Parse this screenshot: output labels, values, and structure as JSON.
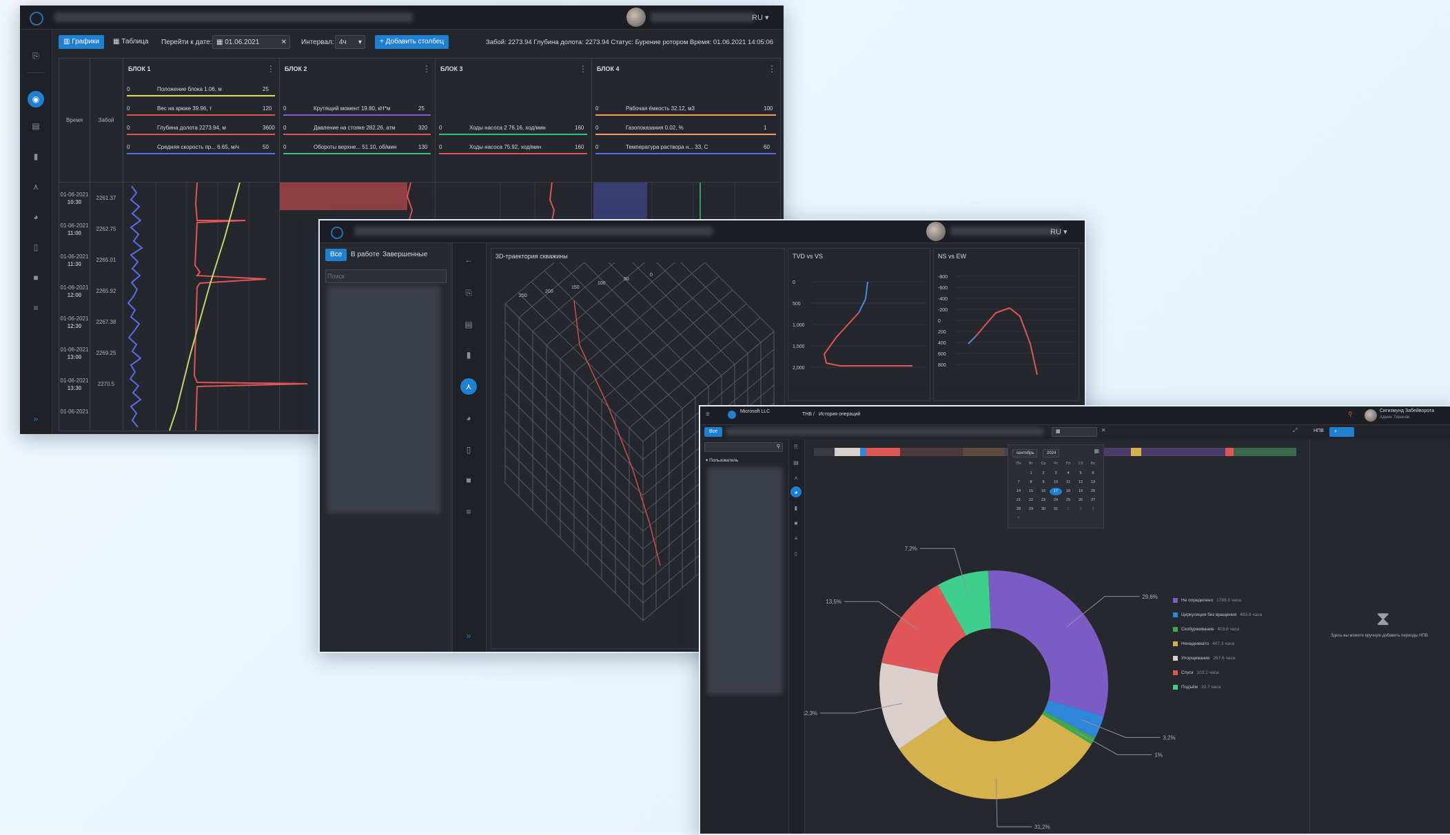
{
  "window1": {
    "lang": "RU",
    "toolbar": {
      "graphs_label": "Графики",
      "table_label": "Таблица",
      "goto_date_label": "Перейти к дате:",
      "date_value": "01.06.2021",
      "interval_label": "Интервал:",
      "interval_value": "4ч",
      "add_column_label": "+ Добавить столбец",
      "status_line": "Забой: 2273.94    Глубина долота: 2273.94    Статус: Бурение ротором    Время: 01.06.2021 14:05:06"
    },
    "columns": {
      "time": "Время",
      "depth": "Забой"
    },
    "blocks": [
      {
        "title": "БЛОК 1",
        "params": [
          {
            "label": "Положение блока 1.06, м",
            "min": "0",
            "max": "25",
            "color": "#e7e253"
          },
          {
            "label": "Вес на крюке 39.96, т",
            "min": "0",
            "max": "120",
            "color": "#e25555"
          },
          {
            "label": "Глубина долота 2273.94, м",
            "min": "0",
            "max": "3600",
            "color": "#e25555"
          },
          {
            "label": "Средняя скорость пр... 6.65, м/ч",
            "min": "0",
            "max": "50",
            "color": "#5a6ce8"
          }
        ]
      },
      {
        "title": "БЛОК 2",
        "params": [
          {
            "label": "Крутящий момент 19.80, кН*м",
            "min": "0",
            "max": "25",
            "color": "#8a5ad6"
          },
          {
            "label": "Давление на стояке 282.26, атм",
            "min": "0",
            "max": "320",
            "color": "#e25555"
          },
          {
            "label": "Обороты верхне... 51.10, об/мин",
            "min": "0",
            "max": "130",
            "color": "#3fc07a"
          }
        ]
      },
      {
        "title": "БЛОК 3",
        "params": [
          {
            "label": "Ходы насоса 2 76.16, ход/мин",
            "min": "0",
            "max": "160",
            "color": "#3fc07a"
          },
          {
            "label": "Ходы насоса 75.92, ход/мин",
            "min": "0",
            "max": "160",
            "color": "#e25555"
          }
        ]
      },
      {
        "title": "БЛОК 4",
        "params": [
          {
            "label": "Рабочая ёмкость 32.12, м3",
            "min": "0",
            "max": "100",
            "color": "#e7a553"
          },
          {
            "label": "Газопоказания 0.02, %",
            "min": "0",
            "max": "1",
            "color": "#e7a553"
          },
          {
            "label": "Температура раствора н... 33, С",
            "min": "0",
            "max": "60",
            "color": "#5a6ce8"
          }
        ]
      }
    ],
    "rows": [
      {
        "date": "01-06-2021",
        "time": "10:30",
        "depth": "2261.37"
      },
      {
        "date": "01-06-2021",
        "time": "11:00",
        "depth": "2262.75"
      },
      {
        "date": "01-06-2021",
        "time": "11:30",
        "depth": "2265.01"
      },
      {
        "date": "01-06-2021",
        "time": "12:00",
        "depth": "2265.92"
      },
      {
        "date": "01-06-2021",
        "time": "12:30",
        "depth": "2267.38"
      },
      {
        "date": "01-06-2021",
        "time": "13:00",
        "depth": "2269.25"
      },
      {
        "date": "01-06-2021",
        "time": "13:30",
        "depth": "2270.5"
      },
      {
        "date": "01-06-2021",
        "time": "",
        "depth": ""
      }
    ]
  },
  "window2": {
    "lang": "RU",
    "filters": {
      "all": "Все",
      "in_work": "В работе",
      "completed": "Завершенные"
    },
    "search_placeholder": "Поиск",
    "panel_3d_title": "3D-траектория скважины",
    "tvd_title": "TVD vs VS",
    "tvd_ticks": [
      "0",
      "500",
      "1,000",
      "1,500",
      "2,000"
    ],
    "ns_title": "NS vs EW",
    "ns_ticks": [
      "-800",
      "-600",
      "-400",
      "-200",
      "0",
      "200",
      "400",
      "600",
      "800"
    ],
    "grid_ticks": [
      "250",
      "200",
      "150",
      "100",
      "50",
      "0"
    ]
  },
  "window3": {
    "company": "Microsoft LLC",
    "breadcrumb_root": "ТНВ",
    "breadcrumb_page": "История операций",
    "user_name": "Сигизмунд Забейворота",
    "user_role": "Админ Тиранов",
    "tree_root": "Пользователь",
    "calendar": {
      "month": "сентябрь",
      "year": "2024",
      "weekdays": [
        "Пн",
        "Вт",
        "Ср",
        "Чт",
        "Пт",
        "Сб",
        "Вс"
      ],
      "days": [
        "",
        "1",
        "2",
        "3",
        "4",
        "5",
        "6",
        "7",
        "8",
        "9",
        "10",
        "11",
        "12",
        "13",
        "14",
        "15",
        "16",
        "17",
        "18",
        "19",
        "20",
        "21",
        "22",
        "23",
        "24",
        "25",
        "26",
        "27",
        "28",
        "29",
        "30",
        "31",
        "1",
        "2",
        "3",
        "4"
      ],
      "selected": "17"
    },
    "npv_tab": "НПВ",
    "empty_text": "Здесь вы можете вручную добавить периоды НПВ",
    "chart_data": {
      "type": "pie",
      "donut": true,
      "slice_labels": [
        "29,6%",
        "3,2%",
        "1%",
        "31,2%",
        "12,3%",
        "13,5%",
        "7,2%"
      ],
      "values": [
        29.6,
        3.2,
        1.0,
        31.2,
        12.3,
        13.5,
        7.2
      ],
      "colors": [
        "#7b5cc4",
        "#2f86d9",
        "#3fa84f",
        "#d6b24c",
        "#d9cfcc",
        "#e05656",
        "#3ecf8a"
      ],
      "legend": [
        {
          "label": "Не определено",
          "value": "1789.0 часа",
          "color": "#7b5cc4"
        },
        {
          "label": "Циркуляция без вращения",
          "value": "483.6 часа",
          "color": "#2f86d9"
        },
        {
          "label": "Скобурживание",
          "value": "403.6 часа",
          "color": "#3fa84f"
        },
        {
          "label": "Ненадежкато",
          "value": "407.3 часа",
          "color": "#d6b24c"
        },
        {
          "label": "Упорщивание",
          "value": "267.6 часа",
          "color": "#d9cfcc"
        },
        {
          "label": "Спуск",
          "value": "103.2 часа",
          "color": "#e05656"
        },
        {
          "label": "Подъём",
          "value": "32.7 часа",
          "color": "#3ecf8a"
        }
      ],
      "legend_position": "right"
    }
  }
}
